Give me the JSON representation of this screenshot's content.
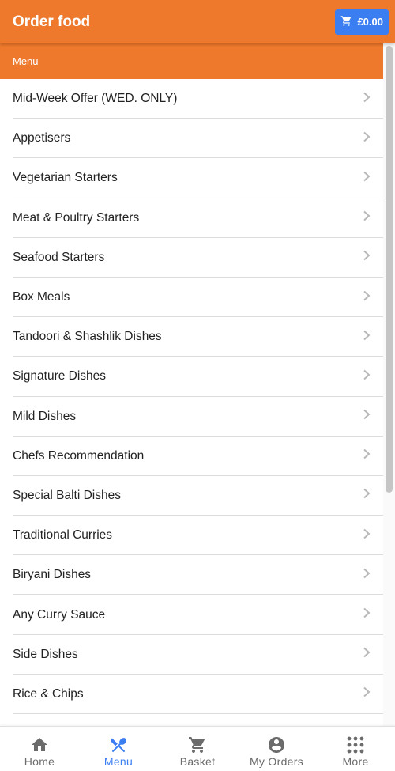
{
  "header": {
    "title": "Order food",
    "basket_total": "£0.00",
    "basket_icon": "cart-icon"
  },
  "subheader": {
    "label": "Menu"
  },
  "menu": {
    "items": [
      {
        "label": "Mid-Week Offer (WED. ONLY)"
      },
      {
        "label": "Appetisers"
      },
      {
        "label": "Vegetarian Starters"
      },
      {
        "label": "Meat & Poultry Starters"
      },
      {
        "label": "Seafood Starters"
      },
      {
        "label": "Box Meals"
      },
      {
        "label": "Tandoori & Shashlik Dishes"
      },
      {
        "label": "Signature Dishes"
      },
      {
        "label": "Mild Dishes"
      },
      {
        "label": "Chefs Recommendation"
      },
      {
        "label": "Special Balti Dishes"
      },
      {
        "label": "Traditional Curries"
      },
      {
        "label": "Biryani Dishes"
      },
      {
        "label": "Any Curry Sauce"
      },
      {
        "label": "Side Dishes"
      },
      {
        "label": "Rice & Chips"
      },
      {
        "label": ""
      }
    ]
  },
  "bottom_nav": {
    "items": [
      {
        "label": "Home",
        "icon": "home-icon"
      },
      {
        "label": "Menu",
        "icon": "fork-knife-icon",
        "active": true
      },
      {
        "label": "Basket",
        "icon": "cart-icon"
      },
      {
        "label": "My Orders",
        "icon": "account-circle-icon"
      },
      {
        "label": "More",
        "icon": "grid-dots-icon"
      }
    ]
  },
  "colors": {
    "primary": "#ee792c",
    "accent": "#3b7ef2",
    "nav_inactive": "#6b6b6b"
  }
}
